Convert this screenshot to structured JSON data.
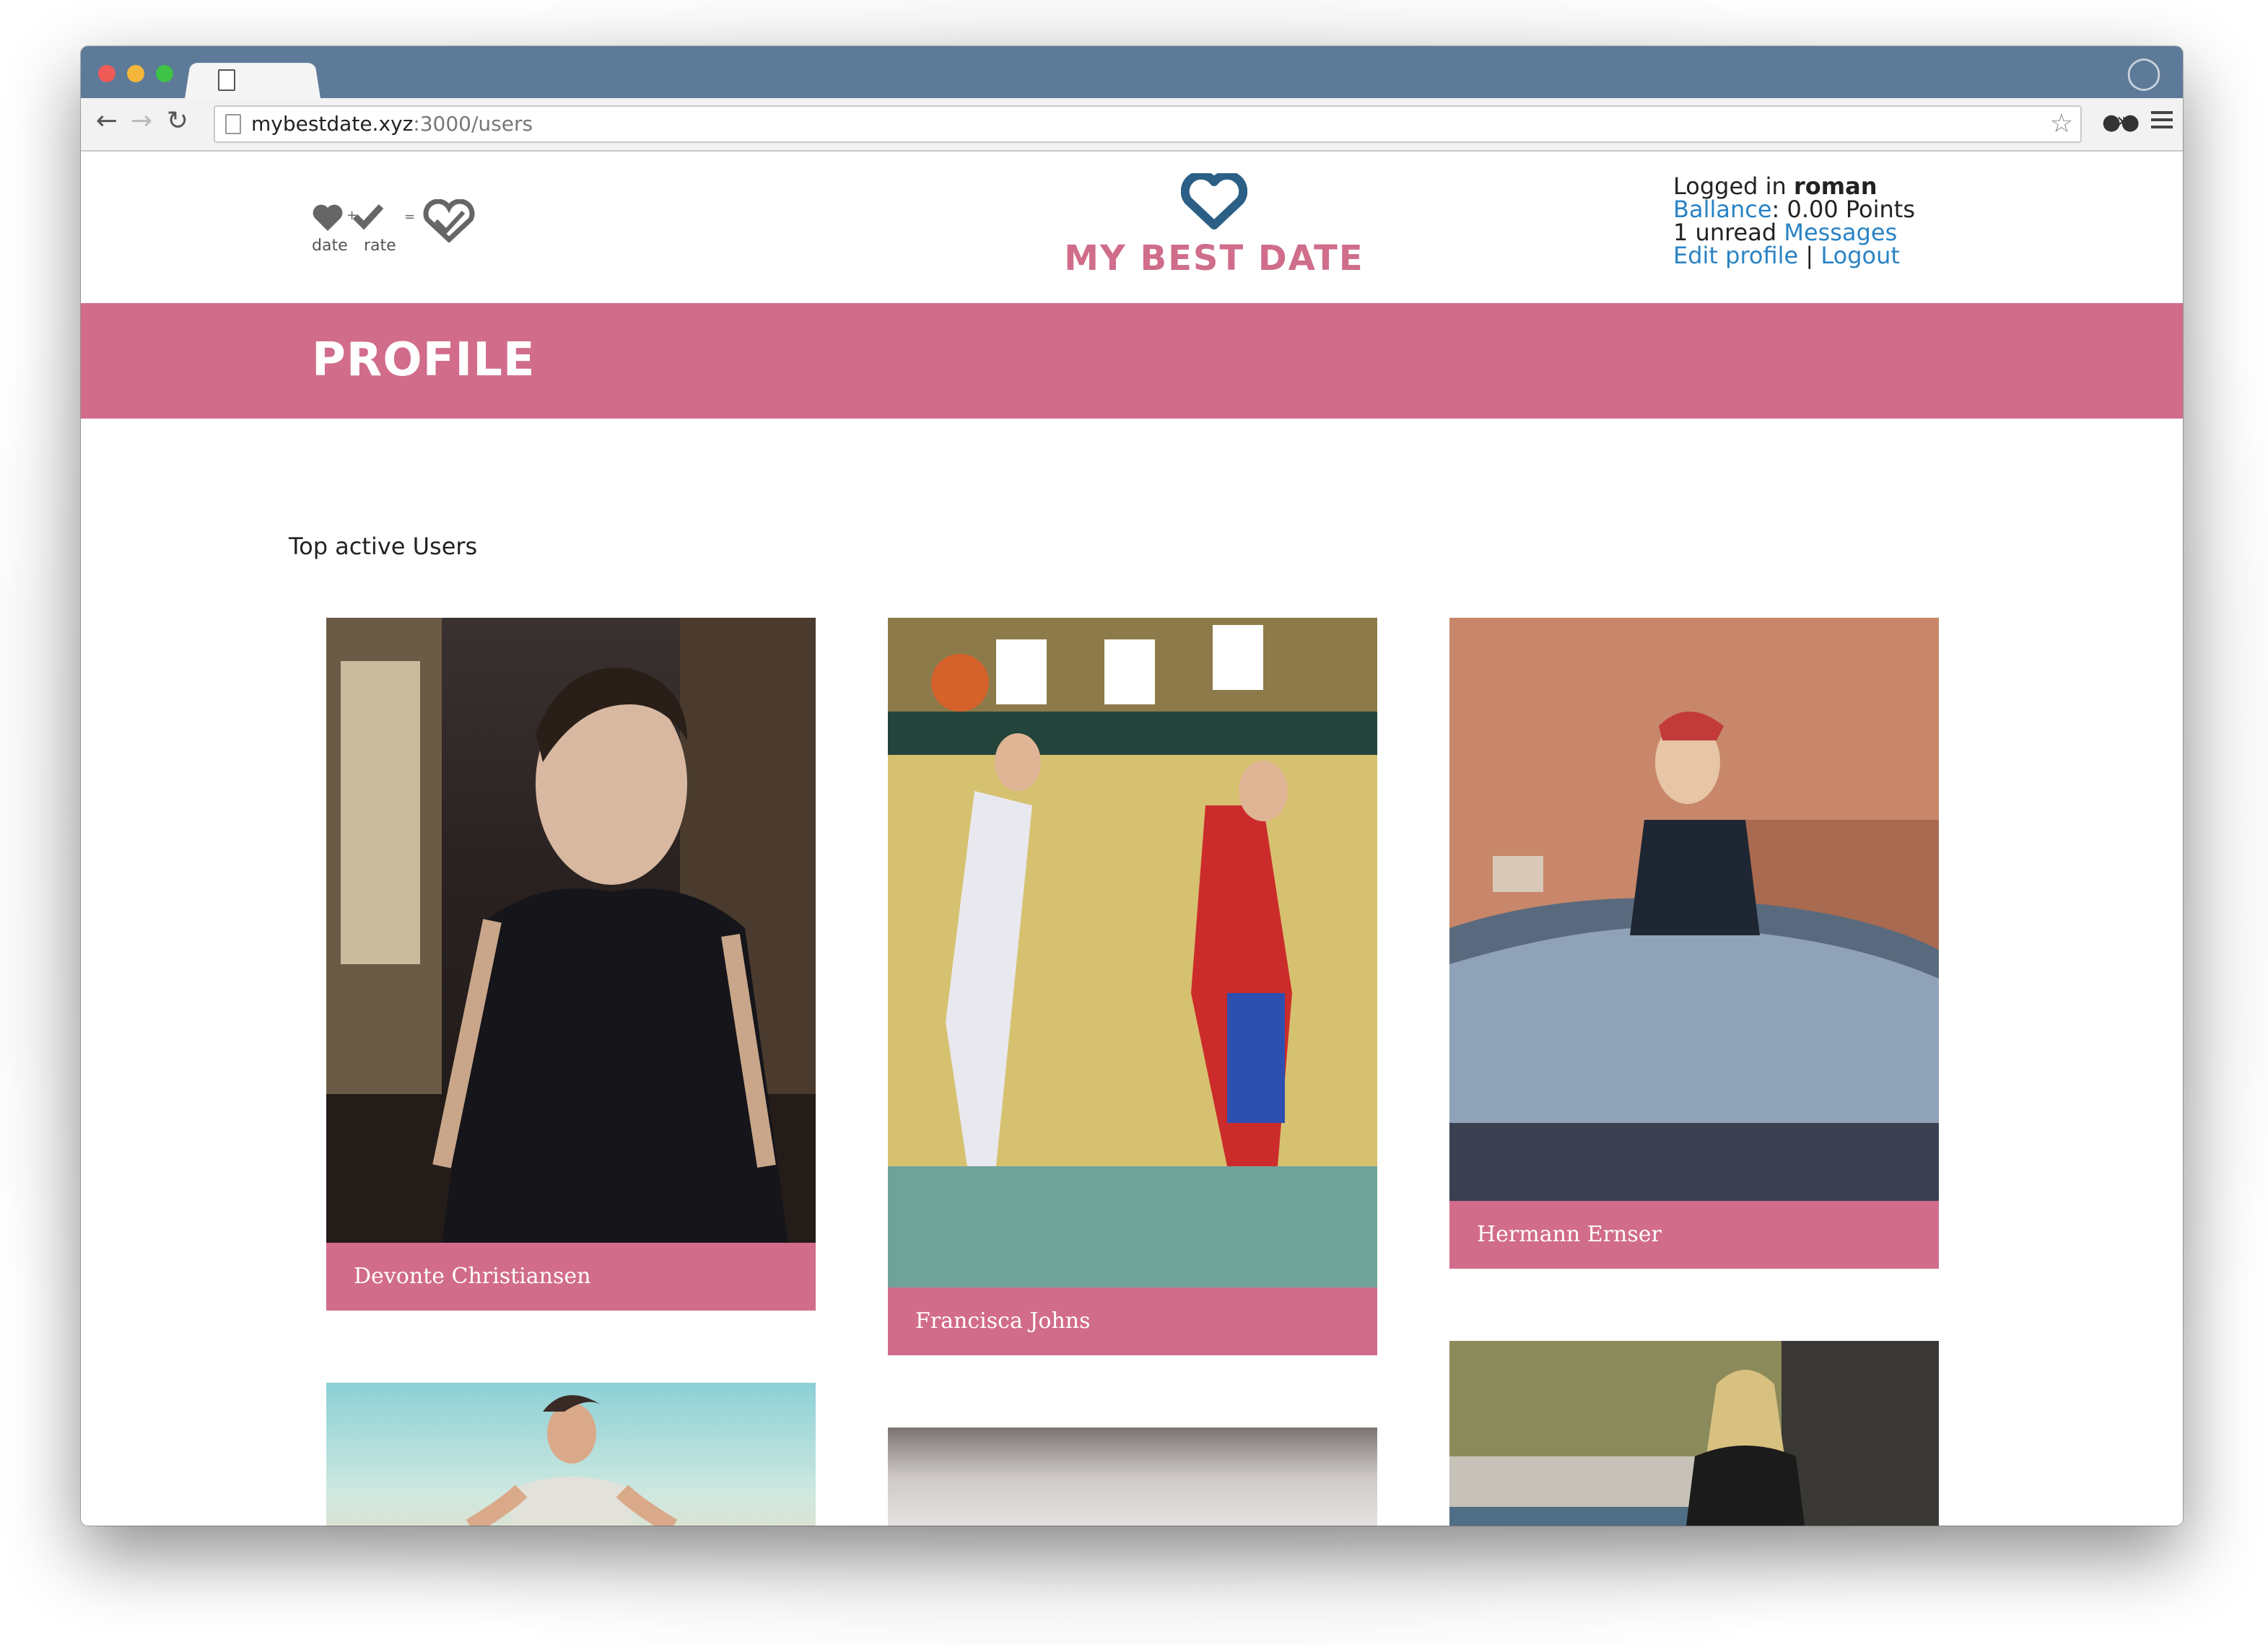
{
  "browser": {
    "url_host": "mybestdate.xyz",
    "url_rest": ":3000/users"
  },
  "logo": {
    "date_label": "date",
    "rate_label": "rate",
    "plus": "+",
    "equals": "="
  },
  "brand": {
    "title": "MY BEST DATE"
  },
  "user": {
    "logged_in_prefix": "Logged in",
    "username": "roman",
    "balance_link": "Ballance",
    "balance_value": ": 0.00 Points",
    "unread_prefix": "1 unread",
    "messages_link": "Messages",
    "edit_profile_link": "Edit profile",
    "separator": "|",
    "logout_link": "Logout"
  },
  "banner": {
    "title": "PROFILE"
  },
  "section": {
    "title": "Top active Users"
  },
  "users": [
    {
      "name": "Devonte Christiansen"
    },
    {
      "name": "Francisca Johns"
    },
    {
      "name": "Hermann Ernser"
    }
  ],
  "colors": {
    "accent_pink": "#d26c8b",
    "brand_pink": "#cf6d8a",
    "link_blue": "#2a83c4",
    "heart_blue": "#2b5f85"
  }
}
